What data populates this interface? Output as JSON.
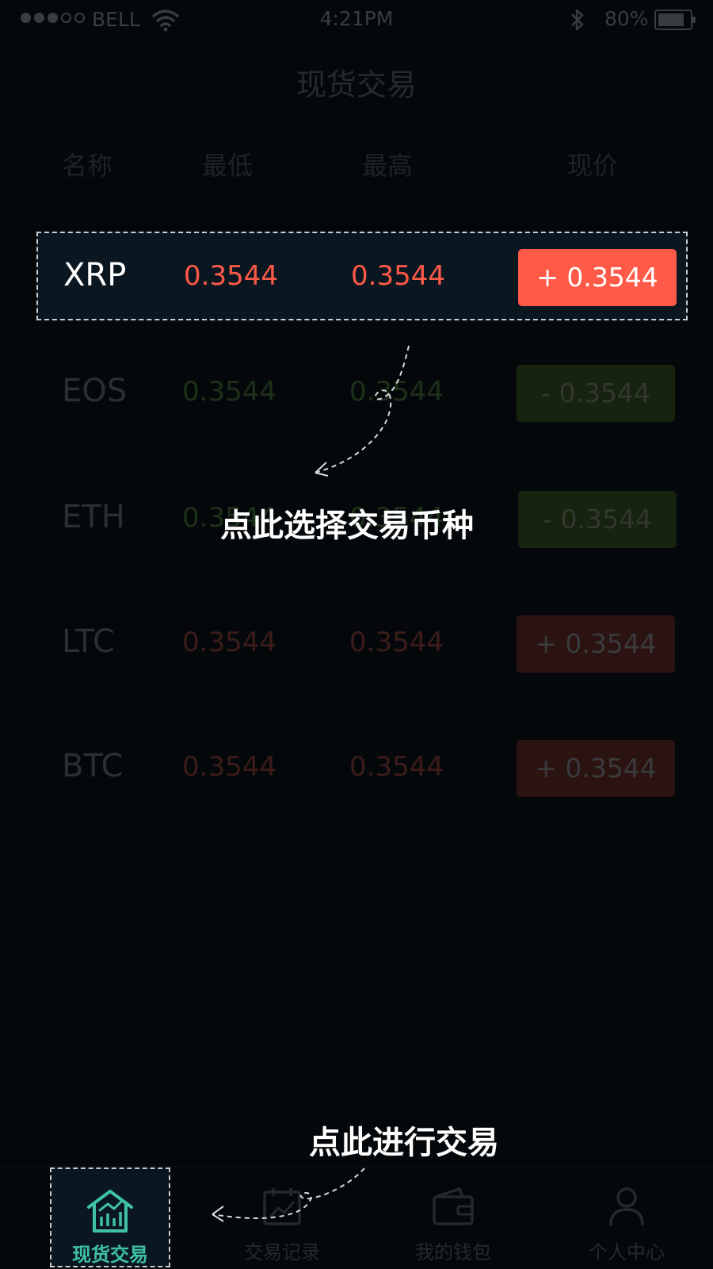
{
  "status_bar": {
    "carrier": "BELL",
    "time": "4:21PM",
    "battery_percent": "80%",
    "signal_filled_dots": 3,
    "signal_total_dots": 5,
    "battery_level": 0.8
  },
  "header": {
    "title": "现货交易"
  },
  "columns": {
    "name": "名称",
    "low": "最低",
    "high": "最高",
    "current": "现价"
  },
  "rows": [
    {
      "symbol": "XRP",
      "low": "0.3544",
      "high": "0.3544",
      "current": "+ 0.3544",
      "trend": "up",
      "highlighted": true
    },
    {
      "symbol": "EOS",
      "low": "0.3544",
      "high": "0.3544",
      "current": "- 0.3544",
      "trend": "down",
      "highlighted": false
    },
    {
      "symbol": "ETH",
      "low": "0.3544",
      "high": "0.3544",
      "current": "- 0.3544",
      "trend": "down",
      "highlighted": false
    },
    {
      "symbol": "LTC",
      "low": "0.3544",
      "high": "0.3544",
      "current": "+ 0.3544",
      "trend": "up",
      "highlighted": false
    },
    {
      "symbol": "BTC",
      "low": "0.3544",
      "high": "0.3544",
      "current": "+ 0.3544",
      "trend": "up",
      "highlighted": false
    }
  ],
  "guides": {
    "select_coin": "点此选择交易币种",
    "trade_here": "点此进行交易"
  },
  "tabbar": {
    "tabs": [
      {
        "label": "现货交易",
        "icon": "chart-house-icon",
        "active": true
      },
      {
        "label": "交易记录",
        "icon": "calendar-chart-icon",
        "active": false
      },
      {
        "label": "我的钱包",
        "icon": "wallet-icon",
        "active": false
      },
      {
        "label": "个人中心",
        "icon": "person-icon",
        "active": false
      }
    ]
  },
  "colors": {
    "up": "#ff5a48",
    "down": "#2e7d20",
    "accent": "#3fc1a6",
    "background": "#05080b"
  }
}
